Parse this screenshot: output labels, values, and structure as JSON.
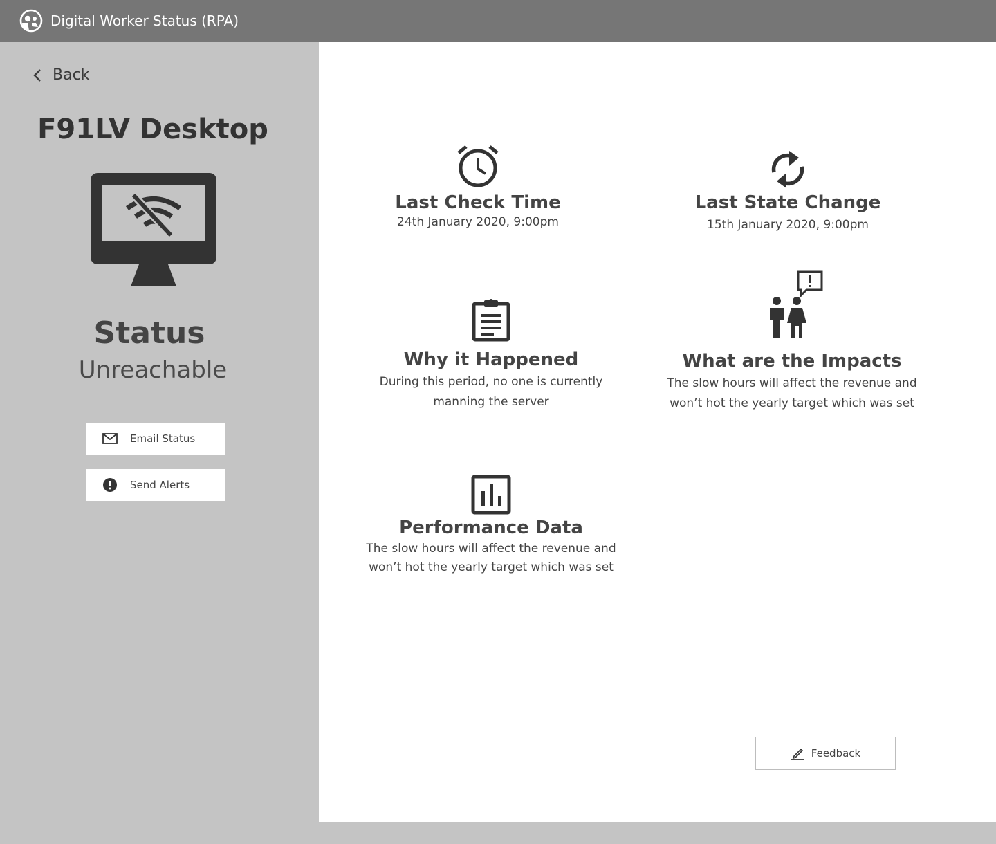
{
  "header": {
    "title": "Digital Worker Status (RPA)",
    "logo_icon": "robot-face-icon"
  },
  "sidebar": {
    "back_label": "Back",
    "device_name": "F91LV Desktop",
    "device_icon": "monitor-wifi-off-icon",
    "status_label": "Status",
    "status_value": "Unreachable",
    "buttons": [
      {
        "label": "Email Status",
        "icon": "mail-icon"
      },
      {
        "label": "Send Alerts",
        "icon": "alert-icon"
      }
    ]
  },
  "main": {
    "cards": [
      {
        "title": "Last Check Time",
        "text": [
          "24th January 2020, 9:00pm"
        ],
        "icon": "alarm-clock-icon"
      },
      {
        "title": "Last State Change",
        "text": [
          "15th January 2020, 9:00pm"
        ],
        "icon": "refresh-icon"
      },
      {
        "title": "Why it Happened",
        "text": [
          "During this period, no one is currently",
          "manning the server"
        ],
        "icon": "clipboard-icon"
      },
      {
        "title": "What are the Impacts",
        "text": [
          "The slow hours will affect the revenue and",
          "won’t hot the yearly target which was set"
        ],
        "icon": "people-alert-icon"
      },
      {
        "title": "Performance Data",
        "text": [
          "The slow hours will affect the revenue and",
          "won’t hot the yearly target which was set"
        ],
        "icon": "bar-chart-icon"
      }
    ],
    "feedback_label": "Feedback"
  },
  "colors": {
    "header_bg": "#767676",
    "sidebar_bg": "#c4c4c4",
    "main_bg": "#ffffff",
    "icon": "#333333"
  }
}
